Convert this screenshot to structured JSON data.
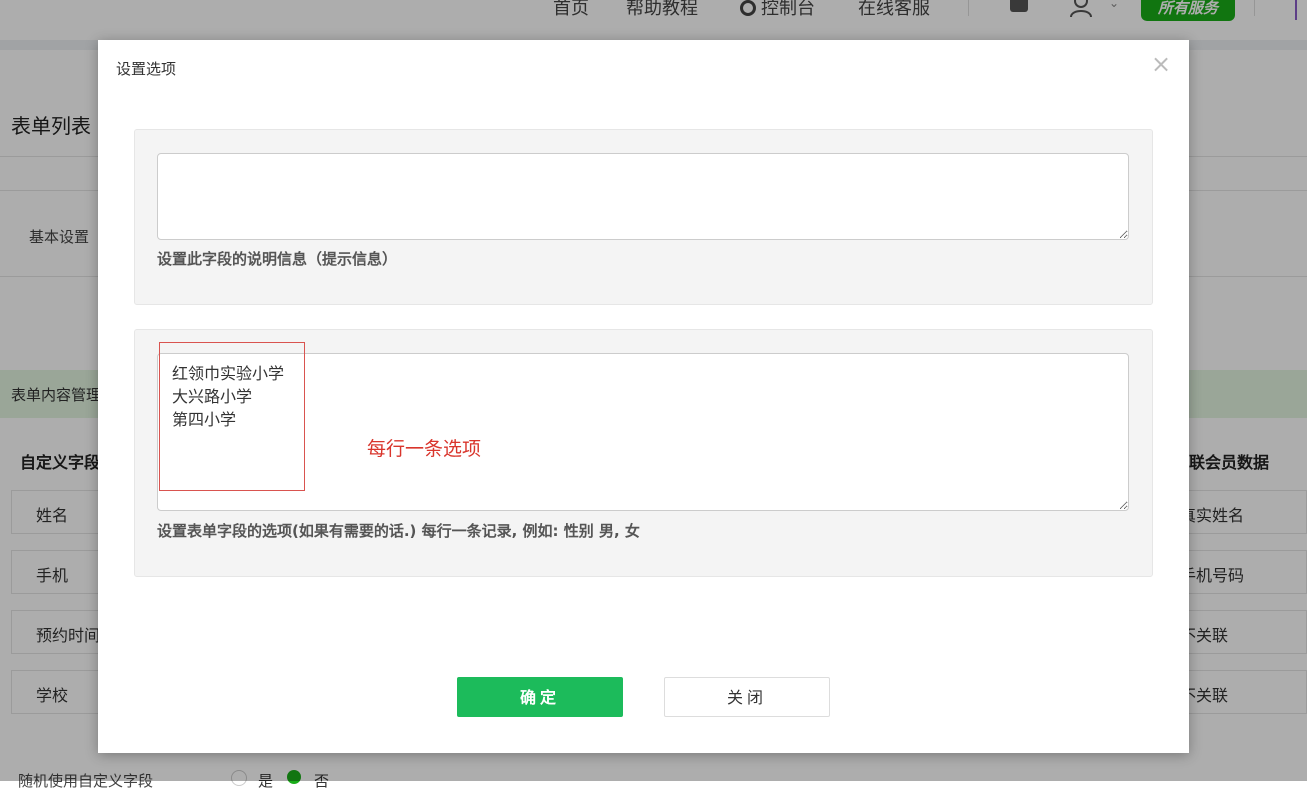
{
  "topnav": {
    "home": "首页",
    "help": "帮助教程",
    "console": "控制台",
    "service": "在线客服",
    "all_services": "所有服务"
  },
  "page": {
    "title": "表单列表",
    "basic_tab": "基本设置",
    "content_section": "表单内容管理",
    "table": {
      "header_left": "自定义字段",
      "header_right": "联会员数据",
      "rows": [
        {
          "field": "姓名",
          "link": "真实姓名"
        },
        {
          "field": "手机",
          "link": "手机号码"
        },
        {
          "field": "预约时间",
          "link": "不关联"
        },
        {
          "field": "学校",
          "link": "不关联"
        }
      ]
    },
    "bottom_label": "随机使用自定义字段",
    "radio_yes": "是",
    "radio_no": "否"
  },
  "modal": {
    "title": "设置选项",
    "close_symbol": "×",
    "description": {
      "value": "",
      "help": "设置此字段的说明信息（提示信息）"
    },
    "options": {
      "value": "红领巾实验小学\n大兴路小学\n第四小学",
      "help": "设置表单字段的选项(如果有需要的话.) 每行一条记录, 例如: 性别 男, 女"
    },
    "annotation": "每行一条选项",
    "confirm_label": "确定",
    "close_label": "关闭"
  },
  "colors": {
    "primary_green": "#1cbb5b",
    "brand_green": "#1aad19",
    "annotation_red": "#d9352c"
  }
}
